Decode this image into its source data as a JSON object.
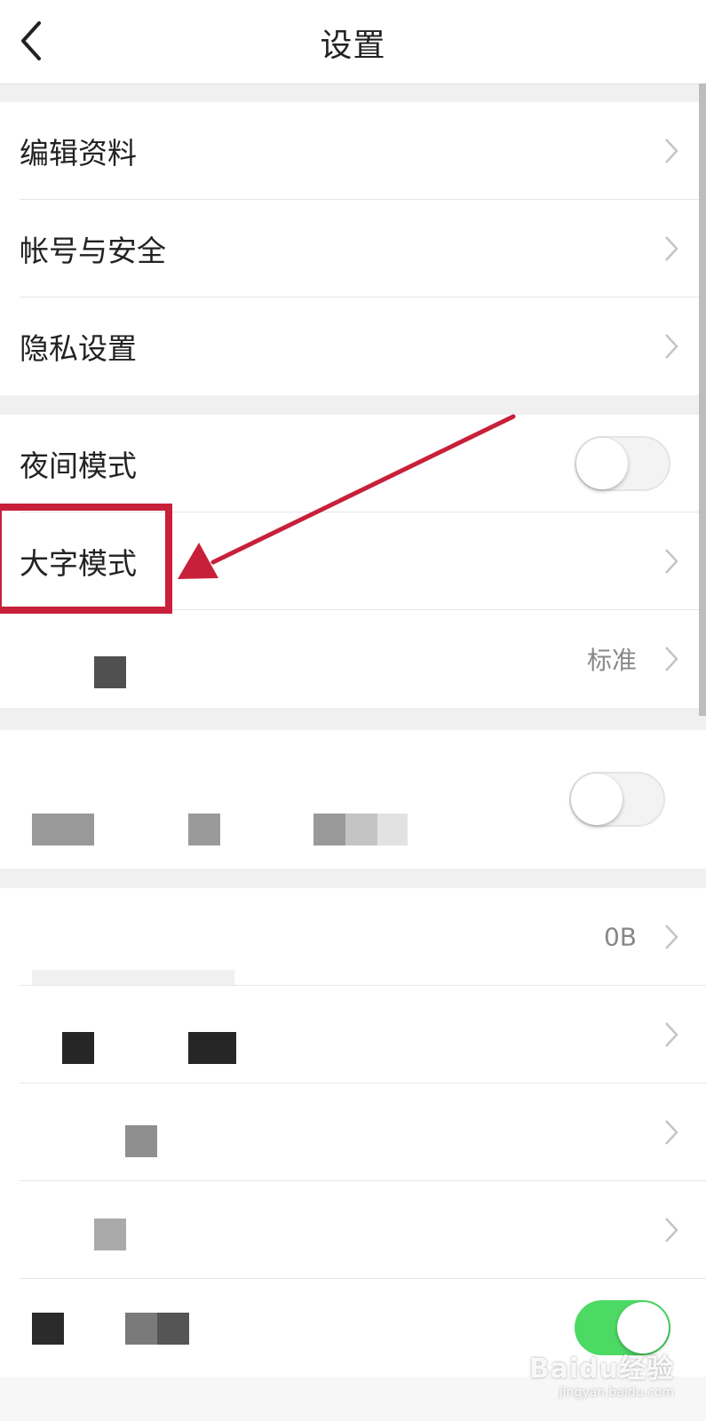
{
  "header": {
    "title": "设置",
    "back_icon": "chevron-left-icon"
  },
  "section_profile": {
    "items": [
      {
        "label": "编辑资料"
      },
      {
        "label": "帐号与安全"
      },
      {
        "label": "隐私设置"
      }
    ]
  },
  "section_display": {
    "night_mode": {
      "label": "夜间模式",
      "enabled": false
    },
    "large_text": {
      "label": "大字模式"
    },
    "font_setting": {
      "value": "标准"
    }
  },
  "section_blurred": {
    "toggle_enabled": false
  },
  "section_storage": {
    "cache": {
      "value": "0B"
    },
    "last_toggle_enabled": true
  },
  "annotation": {
    "highlight_color": "#c8203a"
  },
  "watermark": {
    "main": "Baidu经验",
    "sub": "jingyan.baidu.com"
  },
  "colors": {
    "background": "#ffffff",
    "section_gap": "#f0f0f0",
    "toggle_on": "#4cd964",
    "text_primary": "#222222",
    "text_secondary": "#888888"
  }
}
